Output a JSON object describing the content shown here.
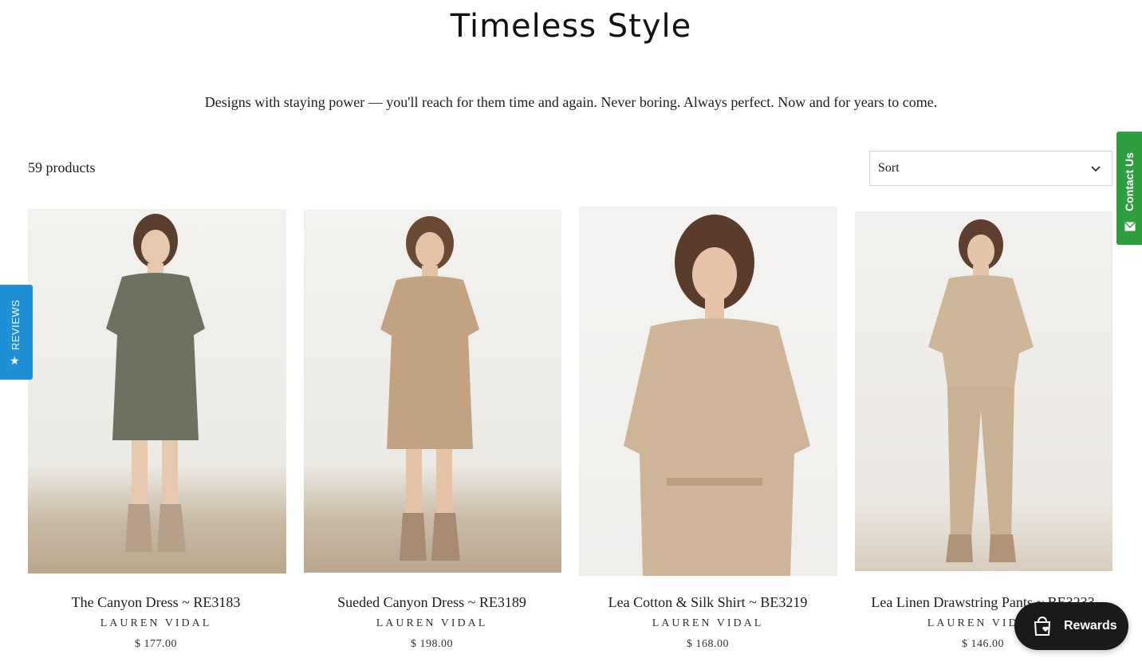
{
  "header": {
    "title": "Timeless Style",
    "description": "Designs with staying power — you'll reach for them time and again. Never boring. Always perfect. Now and for years to come."
  },
  "toolbar": {
    "product_count": "59 products",
    "sort": {
      "selected": "Sort",
      "icon": "chevron-down-icon"
    }
  },
  "products": [
    {
      "title": "The Canyon Dress ~ RE3183",
      "vendor": "LAUREN VIDAL",
      "price": "$ 177.00",
      "garment_color": "#6d7260"
    },
    {
      "title": "Sueded Canyon Dress ~ RE3189",
      "vendor": "LAUREN VIDAL",
      "price": "$ 198.00",
      "garment_color": "#c2a281"
    },
    {
      "title": "Lea Cotton & Silk Shirt ~ BE3219",
      "vendor": "LAUREN VIDAL",
      "price": "$ 168.00",
      "garment_color": "#cfb598"
    },
    {
      "title": "Lea Linen Drawstring Pants ~ BE3233",
      "vendor": "LAUREN VIDAL",
      "price": "$ 146.00",
      "garment_color": "#cdb69a"
    }
  ],
  "widgets": {
    "contact_tab": {
      "label": "Contact Us",
      "icon": "mail-icon",
      "color": "#2f9e3e"
    },
    "reviews_tab": {
      "label": "REVIEWS",
      "icon": "star-icon",
      "color": "#1f8fd6"
    },
    "rewards": {
      "label": "Rewards",
      "icon": "shopping-bag-heart-icon"
    }
  }
}
